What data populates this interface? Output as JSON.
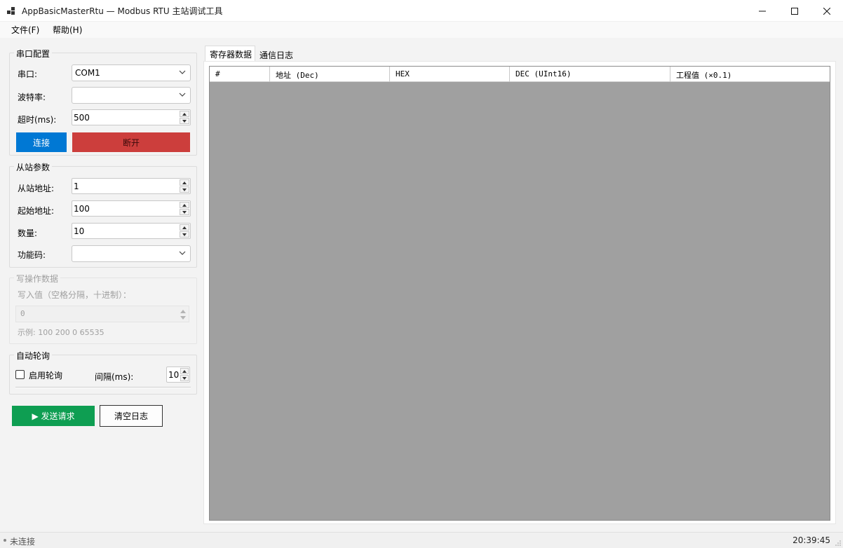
{
  "window": {
    "title": "AppBasicMasterRtu — Modbus RTU 主站调试工具"
  },
  "menu": {
    "file": "文件(F)",
    "help": "帮助(H)"
  },
  "serial": {
    "group_title": "串口配置",
    "port_label": "串口:",
    "port_value": "COM1",
    "baud_label": "波特率:",
    "baud_value": "",
    "timeout_label": "超时(ms):",
    "timeout_value": "500",
    "connect_label": "连接",
    "disconnect_label": "断开"
  },
  "slave": {
    "group_title": "从站参数",
    "address_label": "从站地址:",
    "address_value": "1",
    "start_label": "起始地址:",
    "start_value": "100",
    "count_label": "数量:",
    "count_value": "10",
    "func_label": "功能码:",
    "func_value": ""
  },
  "write": {
    "group_title": "写操作数据",
    "input_label": "写入值（空格分隔，十进制）：",
    "input_value": "0",
    "example": "示例: 100 200 0 65535"
  },
  "polling": {
    "group_title": "自动轮询",
    "enable_label": "启用轮询",
    "interval_label": "间隔(ms):",
    "interval_value": "10"
  },
  "actions": {
    "send_label": "▶ 发送请求",
    "clear_label": "清空日志"
  },
  "tabs": [
    {
      "label": "寄存器数据",
      "active": true
    },
    {
      "label": "通信日志",
      "active": false
    }
  ],
  "grid": {
    "columns": [
      "#",
      "地址 (Dec)",
      "HEX",
      "DEC (UInt16)",
      "工程值 (×0.1)"
    ]
  },
  "status": {
    "text": "未连接",
    "time": "20:39:45"
  },
  "colors": {
    "connect": "#0078d4",
    "disconnect": "#cc3e3c",
    "send": "#0e9e52",
    "grid_bg": "#a0a0a0"
  }
}
